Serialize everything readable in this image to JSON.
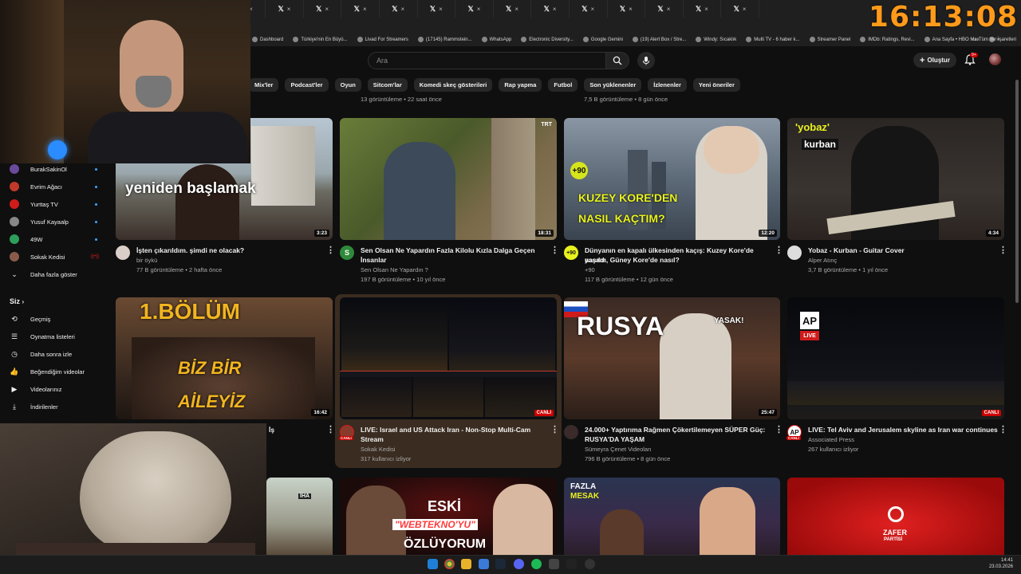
{
  "clock": "16:13:08",
  "tabs": [
    "𝕏",
    "𝕏",
    "𝕏",
    "𝕏",
    "𝕏",
    "𝕏",
    "𝕏",
    "𝕏",
    "𝕏",
    "𝕏",
    "𝕏",
    "𝕏",
    "𝕏",
    "𝕏",
    "𝕏",
    "𝕏",
    "𝕏",
    "𝕏",
    "𝕏",
    "𝕏"
  ],
  "tab_close": "×",
  "bookmarks": [
    "Dashboard",
    "Türkiye'nin En Büyü...",
    "Livad For Streamers",
    "(17145) Rammstein...",
    "WhatsApp",
    "Electronic Diversity...",
    "Google Gemini",
    "(19) Alert Box / Stre...",
    "Windy: Sıcaklık",
    "Multi TV - 6 haber k...",
    "Streamer Panel",
    "IMDb: Ratings, Revi...",
    "Ana Sayfa • HBO Max",
    "»"
  ],
  "all_bookmarks": "Tüm Yer İşaretleri",
  "search": {
    "placeholder": "Ara"
  },
  "create_label": "Oluştur",
  "notif_badge": "9+",
  "chips": [
    "Mix'ler",
    "Podcast'ler",
    "Oyun",
    "Sitcom'lar",
    "Komedi skeç gösterileri",
    "Rap yapma",
    "Futbol",
    "Son yüklenenler",
    "İzlenenler",
    "Yeni öneriler"
  ],
  "top_meta": [
    "13 görüntüleme • 22 saat önce",
    "7,5 B görüntüleme • 8 gün önce"
  ],
  "sidebar": {
    "subs": [
      {
        "label": "BurakSakinOl",
        "color": "#6a4a9a"
      },
      {
        "label": "Evrim Ağacı",
        "color": "#c0392b"
      },
      {
        "label": "Yurttaş TV",
        "color": "#d01b1b"
      },
      {
        "label": "Yusuf Kayaalp",
        "color": "#888888"
      },
      {
        "label": "49W",
        "color": "#2e9e5b"
      },
      {
        "label": "Sokak Kedisi",
        "color": "#8a5b4a"
      }
    ],
    "show_more": "Daha fazla göster",
    "siz": "Siz",
    "you_items": [
      "Geçmiş",
      "Oynatma listeleri",
      "Daha sonra izle",
      "Beğendiğim videolar",
      "Videolarınız",
      "İndirilenler"
    ]
  },
  "videos_row1": [
    {
      "title": "İşten çıkarıldım. şimdi ne olacak?",
      "title2": "",
      "channel": "bir öykü",
      "meta": "77 B görüntüleme • 2 hafta önce",
      "duration": "3:23",
      "overlay": "yeniden başlamak"
    },
    {
      "title": "Sen Olsan Ne Yapardın    Fazla Kilolu Kızla Dalga Geçen",
      "title2": "İnsanlar",
      "channel": "Sen Olsan Ne Yapardın ?",
      "meta": "197 B görüntüleme • 10 yıl önce",
      "duration": "18:31",
      "overlay": "TRT"
    },
    {
      "title": "Dünyanın en kapalı ülkesinden kaçış: Kuzey Kore'de yaşam",
      "title2": "nasıldı, Güney Kore'de nasıl?",
      "channel": "+90",
      "meta": "117 B görüntüleme • 12 gün önce",
      "duration": "12:20",
      "overlay": "KUZEY KORE'DEN",
      "overlay2": "NASIL KAÇTIM?",
      "badge": "+90"
    },
    {
      "title": "Yobaz - Kurban - Guitar Cover",
      "title2": "",
      "channel": "Alper Atınç",
      "meta": "3,7 B görüntüleme • 1 yıl önce",
      "duration": "4:34",
      "overlay": "'yobaz'",
      "overlay2": "kurban"
    }
  ],
  "videos_row2": [
    {
      "title": "İş",
      "title2": "",
      "channel": "",
      "meta": "",
      "duration": "16:42",
      "overlay": "1.BÖLÜM",
      "overlay2": "BİZ BİR",
      "overlay3": "AİLEYİZ"
    },
    {
      "title": "LIVE: Israel and US Attack Iran - Non-Stop Multi-Cam",
      "title2": "Stream",
      "channel": "Sokak Kedisi",
      "meta": "317 kullanıcı izliyor",
      "duration": "CANLI",
      "avatar_label": "CANLI"
    },
    {
      "title": "24.000+ Yaptırıma Rağmen Çökertilemeyen SÜPER Güç:",
      "title2": "RUSYA'DA YAŞAM",
      "channel": "Sümeyra Çenet Videoları",
      "meta": "796 B görüntüleme • 8 gün önce",
      "duration": "25:47",
      "overlay": "RUSYA",
      "overlay2": "YASAK!"
    },
    {
      "title": "LIVE: Tel Aviv and Jerusalem skyline as Iran war continues",
      "title2": "",
      "channel": "Associated Press",
      "meta": "267 kullanıcı izliyor",
      "duration": "CANLI",
      "overlay": "AP",
      "overlay2": "LIVE",
      "avatar_label": "CANLI"
    }
  ],
  "videos_row3": [
    {
      "overlay": "İHA"
    },
    {
      "overlay": "ESKİ",
      "overlay2": "\"WEBTEKNO'YU\"",
      "overlay3": "ÖZLÜYORUM"
    },
    {
      "overlay": "FAZLA",
      "overlay2": "MESAK"
    },
    {
      "overlay": "ZAFER",
      "overlay2": "PARTİSİ"
    }
  ],
  "taskbar": {
    "time": "14:41",
    "date": "23.03.2026"
  },
  "colors": {
    "bg": "#0f0f0f",
    "chip": "#272727",
    "live_red": "#cc0000",
    "clock": "#ff9a1a",
    "verify_blue": "#3ea6ff"
  }
}
